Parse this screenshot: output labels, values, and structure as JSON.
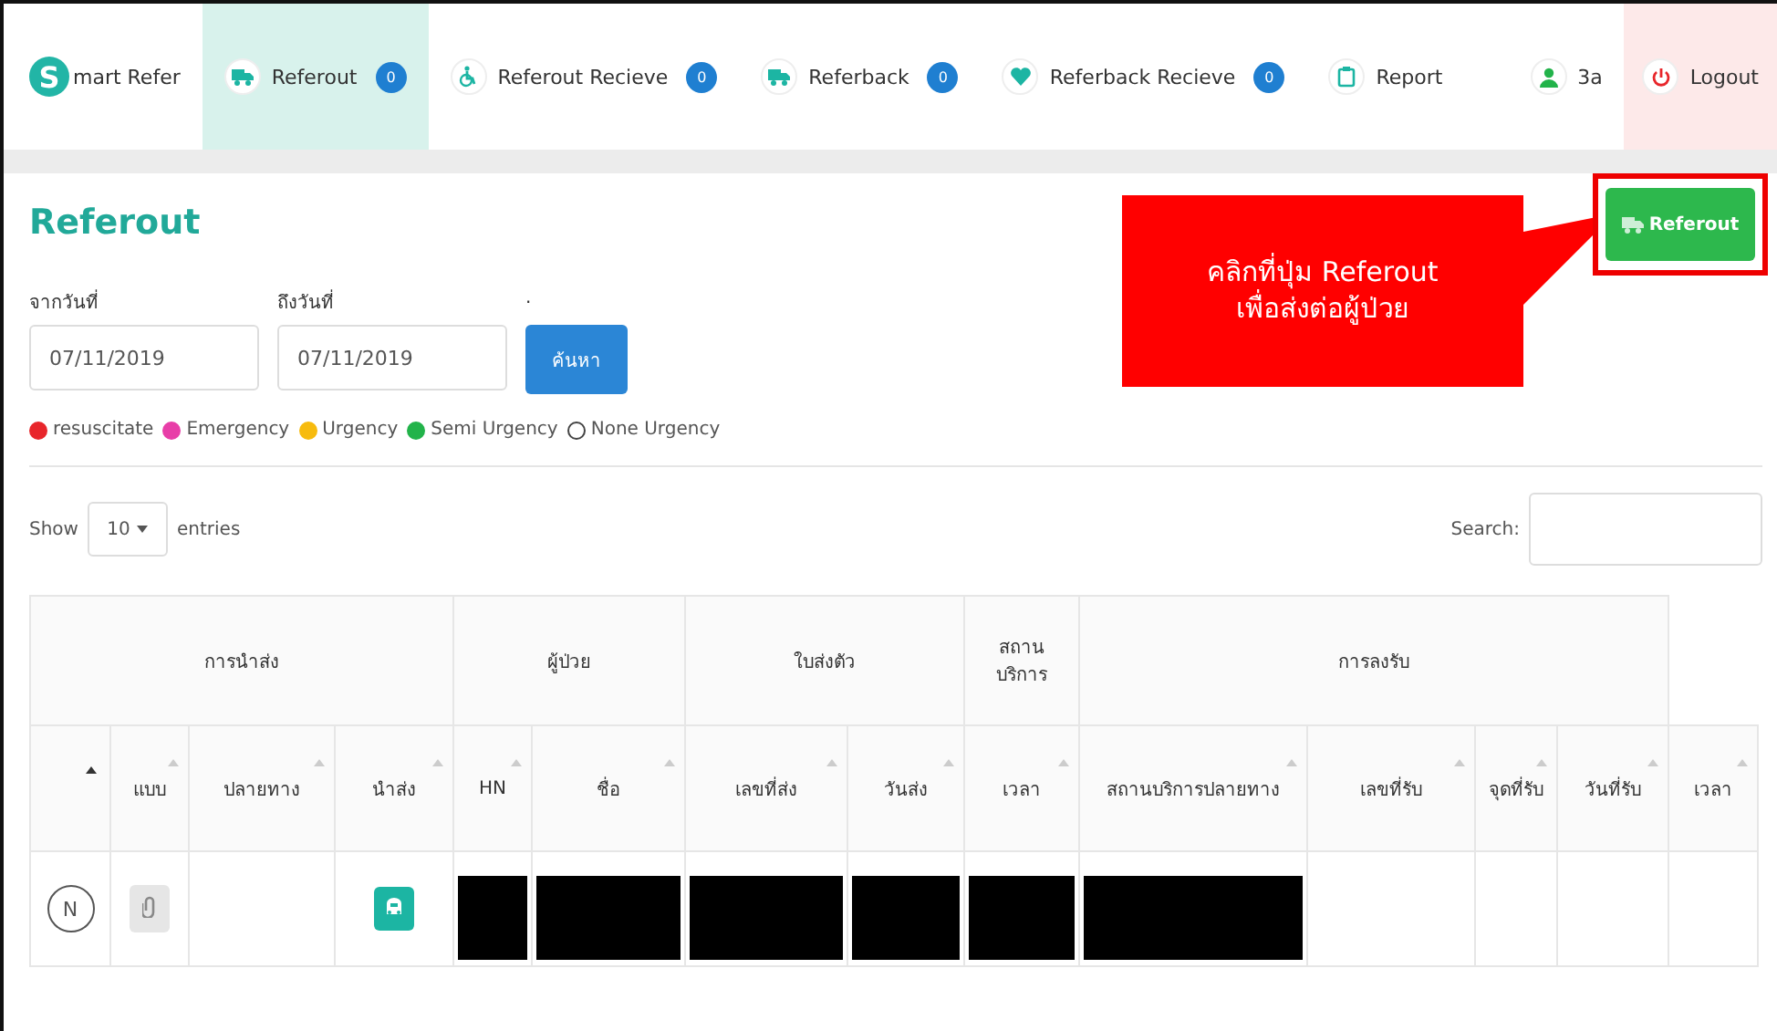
{
  "brand": {
    "mark": "S",
    "text": "mart Refer"
  },
  "nav": [
    {
      "label": "Referout",
      "badge": "0",
      "selected": true
    },
    {
      "label": "Referout Recieve",
      "badge": "0",
      "selected": false
    },
    {
      "label": "Referback",
      "badge": "0",
      "selected": false
    },
    {
      "label": "Referback Recieve",
      "badge": "0",
      "selected": false
    },
    {
      "label": "Report",
      "selected": false
    }
  ],
  "user": "3a",
  "logout": "Logout",
  "page_title": "Referout",
  "action_button": "Referout",
  "callout": "คลิกที่ปุ่ม Referout\nเพื่อส่งต่อผู้ป่วย",
  "filters": [
    {
      "label": "จากวันที่",
      "value": "07/11/2019"
    },
    {
      "label": "ถึงวันที่",
      "value": "07/11/2019"
    }
  ],
  "search_button_label": ".",
  "search_button": "ค้นหา",
  "legend": [
    {
      "label": "resuscitate",
      "color": "#e8262b"
    },
    {
      "label": "Emergency",
      "color": "#e83ea8"
    },
    {
      "label": "Urgency",
      "color": "#f7bb0e"
    },
    {
      "label": "Semi Urgency",
      "color": "#22b34a"
    },
    {
      "label": "None Urgency"
    }
  ],
  "length": {
    "prefix": "Show",
    "value": "10",
    "suffix": "entries"
  },
  "search_label": "Search:",
  "table": {
    "groups": [
      {
        "label": "การนำส่ง"
      },
      {
        "label": "ผู้ป่วย"
      },
      {
        "label": "ใบส่งตัว"
      },
      {
        "label": "สถาน บริการ"
      },
      {
        "label": "การลงรับ"
      }
    ],
    "columns": [
      {
        "sorted": true
      },
      {
        "label": "แบบ",
        "sorted": false
      },
      {
        "label": "ปลายทาง",
        "sorted": false
      },
      {
        "label": "นำส่ง",
        "sorted": false
      },
      {
        "label": "HN",
        "sorted": false
      },
      {
        "label": "ชื่อ",
        "sorted": false
      },
      {
        "label": "เลขที่ส่ง",
        "sorted": false
      },
      {
        "label": "วันส่ง",
        "sorted": false
      },
      {
        "label": "เวลา",
        "sorted": false
      },
      {
        "label": "สถานบริการปลายทาง",
        "sorted": false
      },
      {
        "label": "เลขที่รับ",
        "sorted": false
      },
      {
        "label": "จุดที่รับ",
        "sorted": false
      },
      {
        "label": "วันที่รับ",
        "sorted": false
      },
      {
        "label": "เวลา",
        "sorted": false
      }
    ],
    "rows": [
      {
        "cells": [
          {
            "kind": "level",
            "text": "N"
          },
          {
            "kind": "attachment"
          },
          {
            "kind": "empty"
          },
          {
            "kind": "send"
          },
          {
            "kind": "redacted"
          },
          {
            "kind": "redacted"
          },
          {
            "kind": "redacted"
          },
          {
            "kind": "redacted"
          },
          {
            "kind": "redacted"
          },
          {
            "kind": "redacted"
          },
          {
            "kind": "empty"
          },
          {
            "kind": "empty"
          },
          {
            "kind": "empty"
          },
          {
            "kind": "empty"
          }
        ]
      }
    ]
  }
}
